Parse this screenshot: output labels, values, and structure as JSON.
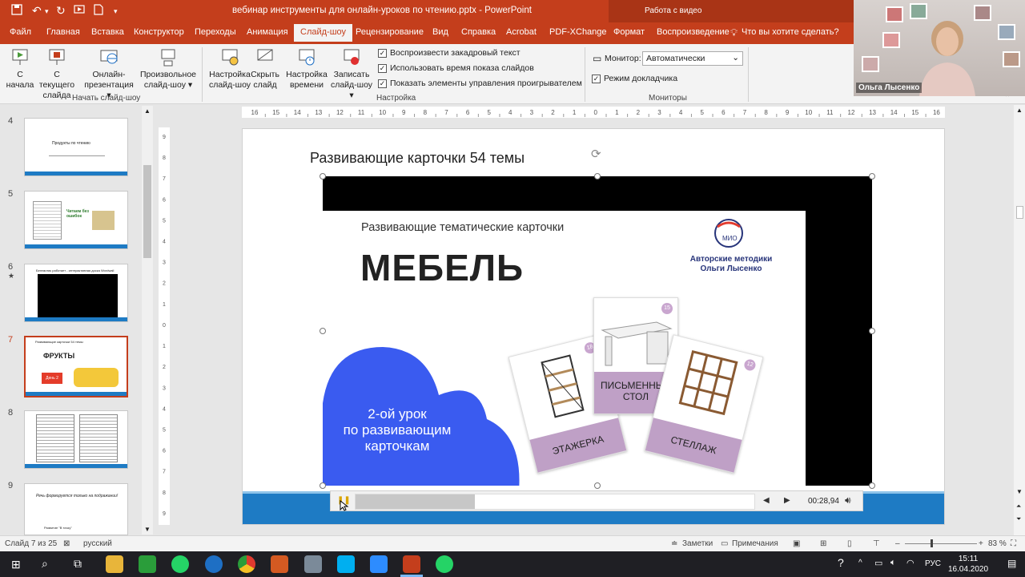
{
  "window": {
    "title": "вебинар инструменты для онлайн-уроков по чтению.pptx  -  PowerPoint",
    "contextual_header": "Работа с видео"
  },
  "tabs": [
    "Файл",
    "Главная",
    "Вставка",
    "Конструктор",
    "Переходы",
    "Анимация",
    "Слайд-шоу",
    "Рецензирование",
    "Вид",
    "Справка",
    "Acrobat",
    "PDF-XChange",
    "Формат",
    "Воспроизведение"
  ],
  "active_tab": "Слайд-шоу",
  "tellme": "Что вы хотите сделать?",
  "ribbon": {
    "btn_from_start": "С начала",
    "btn_from_current": "С текущего слайда",
    "btn_online": "Онлайн-презентация ▾",
    "btn_custom": "Произвольное слайд-шоу ▾",
    "group_start": "Начать слайд-шоу",
    "btn_setup": "Настройка слайд-шоу",
    "btn_hide": "Скрыть слайд",
    "btn_timing": "Настройка времени",
    "btn_record": "Записать слайд-шоу ▾",
    "chk_narration": "Воспроизвести закадровый текст",
    "chk_timings": "Использовать время показа слайдов",
    "chk_controls": "Показать элементы управления проигрывателем",
    "group_setup": "Настройка",
    "monitor_label": "Монитор:",
    "monitor_value": "Автоматически",
    "chk_presenter": "Режим докладчика",
    "group_monitors": "Мониторы"
  },
  "webcam": {
    "name": "Ольга Лысенко"
  },
  "thumbs": {
    "items": [
      {
        "num": "4",
        "text": "Продукты по чтению"
      },
      {
        "num": "5",
        "text": "Читаем без ошибок"
      },
      {
        "num": "6",
        "text": "Бегемотик работает - интерактивная доска Wordwall"
      },
      {
        "num": "7",
        "text": "ФРУКТЫ"
      },
      {
        "num": "8",
        "text": ""
      },
      {
        "num": "9",
        "text": "Речь формируется только на подражании!"
      }
    ],
    "star": "★",
    "t7_small": "Развивающие карточки 54 темы",
    "t7_badge": "День 2",
    "t5_badge": "Читаем без ошибок",
    "t9_line1": "Речь формируется только на подражании!",
    "t9_line2": "Развитие \"В точку\""
  },
  "slide": {
    "title": "Развивающие карточки 54 темы",
    "video_subtitle": "Развивающие тематические карточки",
    "video_heading": "МЕБЕЛЬ",
    "brand_line1": "Авторские методики",
    "brand_line2": "Ольги Лысенко",
    "logo_text": "МИО",
    "cloud_line1": "2-ой урок",
    "cloud_line2": "по развивающим",
    "cloud_line3": "карточкам",
    "cards": [
      {
        "label": "ЭТАЖЕРКА",
        "num": "18"
      },
      {
        "label": "ПИСЬМЕННЫЙ СТОЛ",
        "num": "15"
      },
      {
        "label": "СТЕЛЛАЖ",
        "num": "12"
      }
    ]
  },
  "player": {
    "time": "00:28,94",
    "progress": 0.3
  },
  "ruler": {
    "h_ticks": [
      "16",
      "15",
      "14",
      "13",
      "12",
      "11",
      "10",
      "9",
      "8",
      "7",
      "6",
      "5",
      "4",
      "3",
      "2",
      "1",
      "0",
      "1",
      "2",
      "3",
      "4",
      "5",
      "6",
      "7",
      "8",
      "9",
      "10",
      "11",
      "12",
      "13",
      "14",
      "15",
      "16"
    ],
    "v_ticks": [
      "9",
      "8",
      "7",
      "6",
      "5",
      "4",
      "3",
      "2",
      "1",
      "0",
      "1",
      "2",
      "3",
      "4",
      "5",
      "6",
      "7",
      "8",
      "9"
    ]
  },
  "status": {
    "slide": "Слайд 7 из 25",
    "lang": "русский",
    "notes": "Заметки",
    "comments": "Примечания",
    "zoom": "83 %"
  },
  "taskbar": {
    "lang": "РУС",
    "time": "15:11",
    "date": "16.04.2020"
  },
  "colors": {
    "accent": "#c43e1c",
    "slide_band": "#1e7bc4",
    "cloud": "#3a5bf0",
    "card_label": "#bfa0c6"
  }
}
